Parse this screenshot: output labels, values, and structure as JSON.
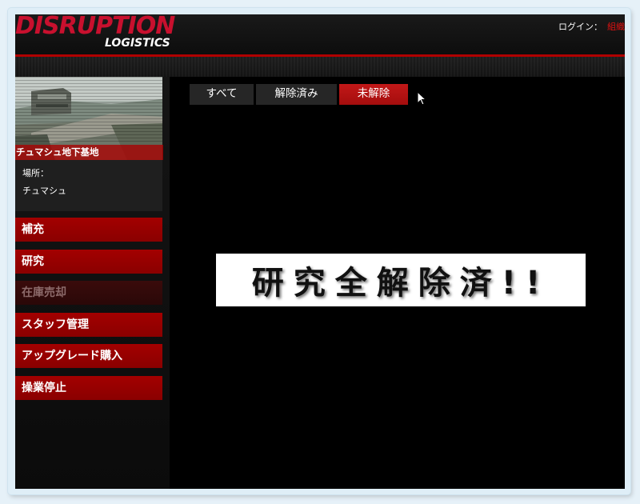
{
  "header": {
    "logo_main": "DISRUPTION",
    "logo_sub": "LOGISTICS",
    "login_label": "ログイン：",
    "login_user": "組織"
  },
  "location": {
    "name": "チュマシュ地下基地",
    "label": "場所：",
    "value": "チュマシュ"
  },
  "menu": {
    "items": [
      {
        "label": "補充",
        "enabled": true
      },
      {
        "label": "研究",
        "enabled": true
      },
      {
        "label": "在庫売却",
        "enabled": false
      },
      {
        "label": "スタッフ管理",
        "enabled": true
      },
      {
        "label": "アップグレード購入",
        "enabled": true
      },
      {
        "label": "操業停止",
        "enabled": true
      }
    ]
  },
  "tabs": [
    {
      "label": "すべて",
      "active": false
    },
    {
      "label": "解除済み",
      "active": false
    },
    {
      "label": "未解除",
      "active": true
    }
  ],
  "banner": {
    "text": "研究全解除済!!"
  },
  "colors": {
    "brand_red": "#c8102e",
    "menu_red": "#a30000",
    "disabled_menu": "#3a0b0b",
    "active_tab": "#c21818"
  }
}
